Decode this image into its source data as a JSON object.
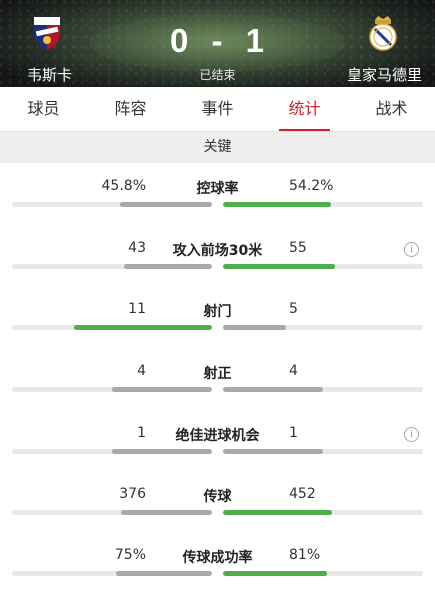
{
  "match": {
    "home_team": "韦斯卡",
    "away_team": "皇家马德里",
    "home_score": "0",
    "away_score": "1",
    "separator": "-",
    "status": "已结束",
    "home_badge_icon": "huesca-crest-icon",
    "away_badge_icon": "real-madrid-crest-icon"
  },
  "tabs": [
    {
      "label": "球员",
      "active": false
    },
    {
      "label": "阵容",
      "active": false
    },
    {
      "label": "事件",
      "active": false
    },
    {
      "label": "统计",
      "active": true
    },
    {
      "label": "战术",
      "active": false
    }
  ],
  "section": {
    "title": "关键"
  },
  "stats": [
    {
      "label": "控球率",
      "left": "45.8%",
      "right": "54.2%",
      "left_share": 0.458,
      "right_share": 0.542,
      "leader": "right",
      "info": false
    },
    {
      "label": "攻入前场30米",
      "left": "43",
      "right": "55",
      "left_share": 0.439,
      "right_share": 0.561,
      "leader": "right",
      "info": true
    },
    {
      "label": "射门",
      "left": "11",
      "right": "5",
      "left_share": 0.6875,
      "right_share": 0.3125,
      "leader": "left",
      "info": false
    },
    {
      "label": "射正",
      "left": "4",
      "right": "4",
      "left_share": 0.5,
      "right_share": 0.5,
      "leader": "none",
      "info": false
    },
    {
      "label": "绝佳进球机会",
      "left": "1",
      "right": "1",
      "left_share": 0.5,
      "right_share": 0.5,
      "leader": "none",
      "info": true
    },
    {
      "label": "传球",
      "left": "376",
      "right": "452",
      "left_share": 0.454,
      "right_share": 0.546,
      "leader": "right",
      "info": false
    },
    {
      "label": "传球成功率",
      "left": "75%",
      "right": "81%",
      "left_share": 0.481,
      "right_share": 0.519,
      "leader": "right",
      "info": false
    }
  ],
  "colors": {
    "accent": "#d0202a",
    "bar_win": "#4fad4a",
    "bar_lose": "#a9a9a9",
    "bar_track": "#e9e9e9"
  },
  "info_icon_glyph": "i"
}
